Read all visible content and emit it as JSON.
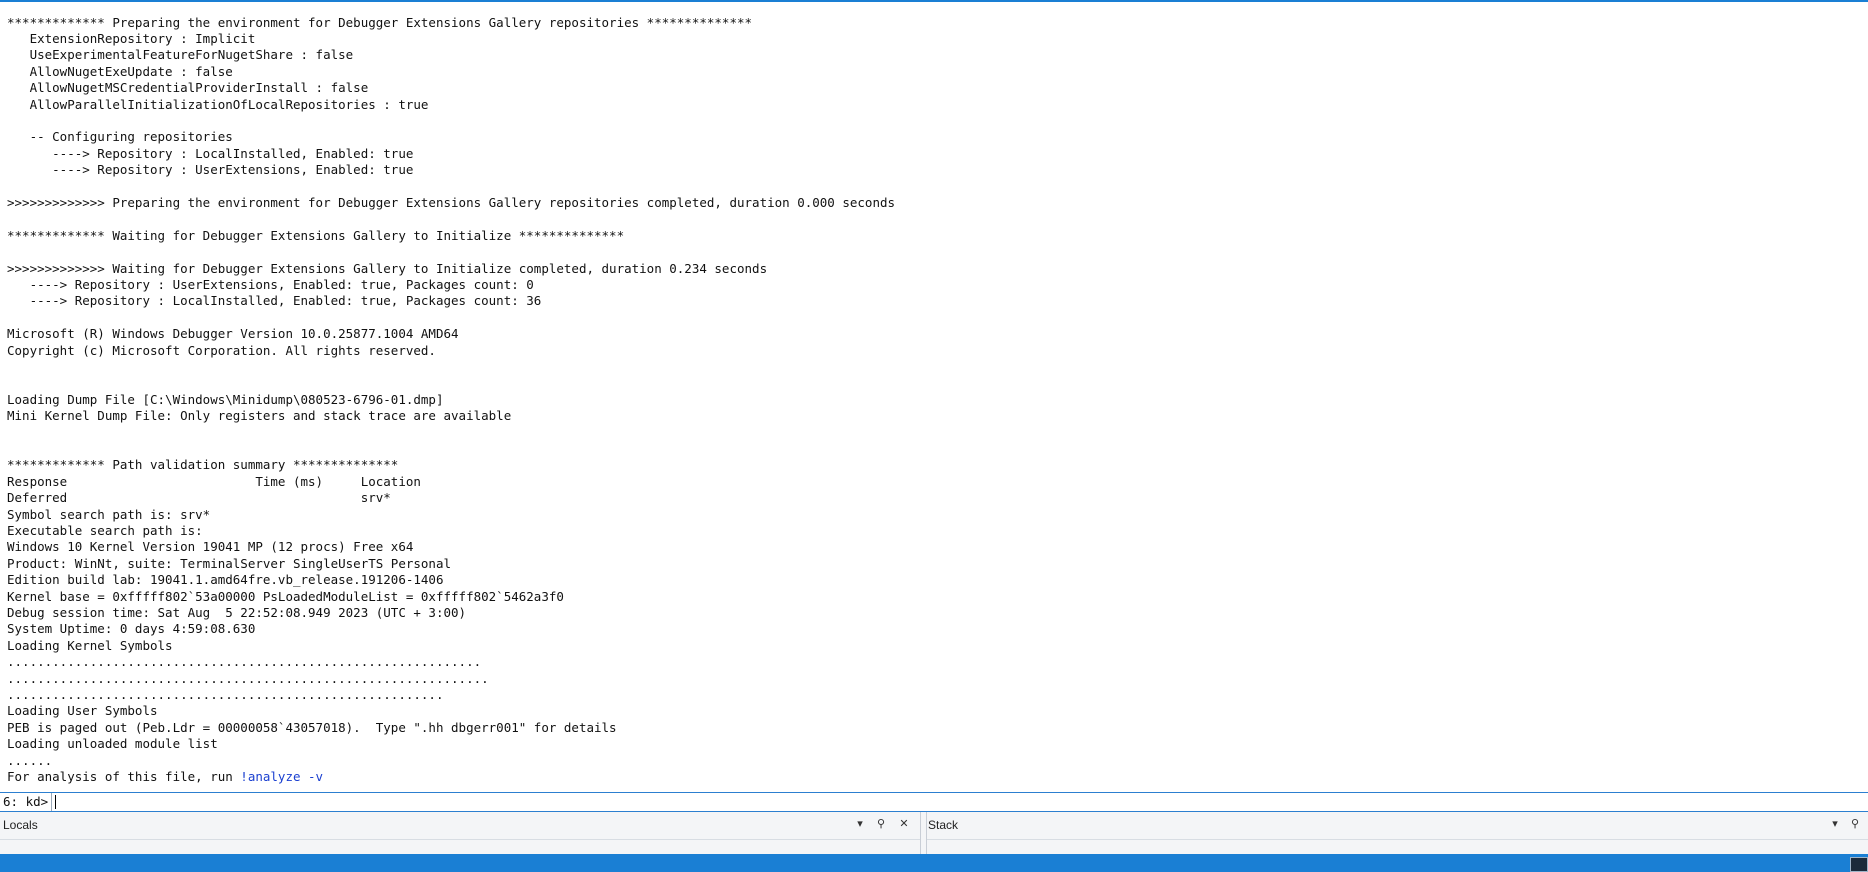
{
  "output_lines": [
    "************* Preparing the environment for Debugger Extensions Gallery repositories **************",
    "   ExtensionRepository : Implicit",
    "   UseExperimentalFeatureForNugetShare : false",
    "   AllowNugetExeUpdate : false",
    "   AllowNugetMSCredentialProviderInstall : false",
    "   AllowParallelInitializationOfLocalRepositories : true",
    "",
    "   -- Configuring repositories",
    "      ----> Repository : LocalInstalled, Enabled: true",
    "      ----> Repository : UserExtensions, Enabled: true",
    "",
    ">>>>>>>>>>>>> Preparing the environment for Debugger Extensions Gallery repositories completed, duration 0.000 seconds",
    "",
    "************* Waiting for Debugger Extensions Gallery to Initialize **************",
    "",
    ">>>>>>>>>>>>> Waiting for Debugger Extensions Gallery to Initialize completed, duration 0.234 seconds",
    "   ----> Repository : UserExtensions, Enabled: true, Packages count: 0",
    "   ----> Repository : LocalInstalled, Enabled: true, Packages count: 36",
    "",
    "Microsoft (R) Windows Debugger Version 10.0.25877.1004 AMD64",
    "Copyright (c) Microsoft Corporation. All rights reserved.",
    "",
    "",
    "Loading Dump File [C:\\Windows\\Minidump\\080523-6796-01.dmp]",
    "Mini Kernel Dump File: Only registers and stack trace are available",
    "",
    "",
    "************* Path validation summary **************",
    "Response                         Time (ms)     Location",
    "Deferred                                       srv*",
    "Symbol search path is: srv*",
    "Executable search path is: ",
    "Windows 10 Kernel Version 19041 MP (12 procs) Free x64",
    "Product: WinNt, suite: TerminalServer SingleUserTS Personal",
    "Edition build lab: 19041.1.amd64fre.vb_release.191206-1406",
    "Kernel base = 0xfffff802`53a00000 PsLoadedModuleList = 0xfffff802`5462a3f0",
    "Debug session time: Sat Aug  5 22:52:08.949 2023 (UTC + 3:00)",
    "System Uptime: 0 days 4:59:08.630",
    "Loading Kernel Symbols",
    "...............................................................",
    "................................................................",
    "..........................................................",
    "Loading User Symbols",
    "PEB is paged out (Peb.Ldr = 00000058`43057018).  Type \".hh dbgerr001\" for details",
    "Loading unloaded module list",
    "......"
  ],
  "analyze_line": {
    "prefix": "For analysis of this file, run ",
    "link": "!analyze -v"
  },
  "command": {
    "prompt": "6: kd>",
    "value": ""
  },
  "panes": {
    "locals": {
      "title": "Locals"
    },
    "stack": {
      "title": "Stack"
    }
  },
  "colors": {
    "accent": "#1a7fd4",
    "link": "#1a3fd0"
  }
}
